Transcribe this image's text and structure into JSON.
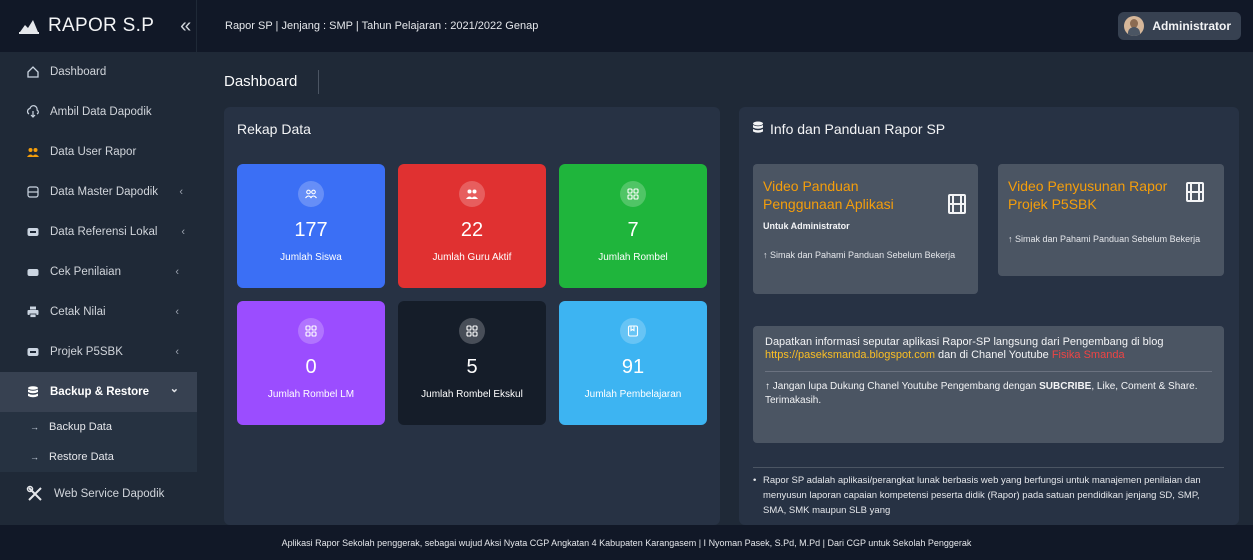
{
  "brand": {
    "name": "RAPOR S.P",
    "collapse_icon": "chevrons-left-icon"
  },
  "header": {
    "breadcrumb": "Rapor SP | Jenjang : SMP | Tahun Pelajaran : 2021/2022 Genap",
    "user_name": "Administrator"
  },
  "sidebar": {
    "items": [
      {
        "label": "Dashboard",
        "icon": "home-icon"
      },
      {
        "label": "Ambil Data Dapodik",
        "icon": "cloud-download-icon"
      },
      {
        "label": "Data User Rapor",
        "icon": "users-icon"
      },
      {
        "label": "Data Master Dapodik",
        "icon": "database-icon",
        "chevron": "‹"
      },
      {
        "label": "Data Referensi Lokal",
        "icon": "archive-icon",
        "chevron": "‹"
      },
      {
        "label": "Cek Penilaian",
        "icon": "archive-icon",
        "chevron": "‹"
      },
      {
        "label": "Cetak Nilai",
        "icon": "printer-icon",
        "chevron": "‹"
      },
      {
        "label": "Projek P5SBK",
        "icon": "archive-icon",
        "chevron": "‹"
      },
      {
        "label": "Backup & Restore",
        "icon": "database-icon",
        "chevron": "⌄"
      },
      {
        "label": "Web Service Dapodik",
        "icon": "tools-icon"
      }
    ],
    "sub_items": [
      {
        "label": "Backup Data",
        "arrow": "→"
      },
      {
        "label": "Restore Data",
        "arrow": "→"
      }
    ]
  },
  "main": {
    "page_title": "Dashboard",
    "rekap": {
      "title": "Rekap Data",
      "stats": [
        {
          "value": "177",
          "label": "Jumlah Siswa",
          "color": "#3b6ff5",
          "icon": "users-icon"
        },
        {
          "value": "22",
          "label": "Jumlah Guru Aktif",
          "color": "#e03131",
          "icon": "teacher-icon"
        },
        {
          "value": "7",
          "label": "Jumlah Rombel",
          "color": "#1fb53c",
          "icon": "grid-icon"
        },
        {
          "value": "0",
          "label": "Jumlah Rombel LM",
          "color": "#9b4dff",
          "icon": "grid-icon"
        },
        {
          "value": "5",
          "label": "Jumlah Rombel Ekskul",
          "color": "#151d29",
          "icon": "grid-icon"
        },
        {
          "value": "91",
          "label": "Jumlah Pembelajaran",
          "color": "#3db4f2",
          "icon": "book-icon"
        }
      ]
    },
    "info": {
      "title": "Info dan Panduan Rapor SP",
      "card1": {
        "title": "Video Panduan Penggunaan Aplikasi",
        "subtitle": "Untuk Administrator",
        "note": "↑ Simak dan Pahami Panduan Sebelum Bekerja"
      },
      "card2": {
        "title": "Video Penyusunan Rapor Projek P5SBK",
        "note": "↑ Simak dan Pahami Panduan Sebelum Bekerja"
      },
      "box": {
        "text_before": "Dapatkan informasi seputar aplikasi Rapor-SP langsung dari Pengembang di blog ",
        "link": "https://paseksmanda.blogspot.com",
        "text_mid": " dan di Chanel Youtube ",
        "channel": "Fisika Smanda",
        "note_before": "↑ Jangan lupa Dukung Chanel Youtube Pengembang dengan ",
        "note_bold": "SUBCRIBE",
        "note_after": ", Like, Coment & Share. Terimakasih."
      },
      "description": "Rapor SP adalah aplikasi/perangkat lunak berbasis web yang berfungsi untuk manajemen penilaian dan menyusun laporan capaian kompetensi peserta didik (Rapor) pada satuan pendidikan jenjang SD, SMP, SMA, SMK maupun SLB yang"
    }
  },
  "footer": {
    "text": "Aplikasi Rapor Sekolah penggerak, sebagai wujud Aksi Nyata CGP Angkatan 4 Kabupaten Karangasem | I Nyoman Pasek, S.Pd, M.Pd | Dari CGP untuk Sekolah Penggerak"
  }
}
